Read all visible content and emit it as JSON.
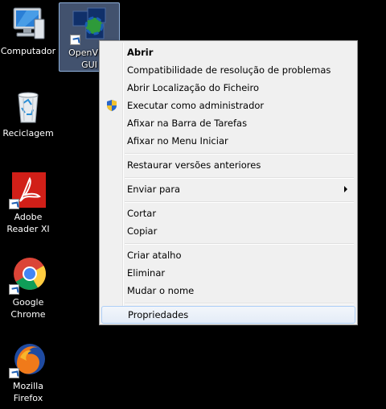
{
  "desktop": {
    "icons": [
      {
        "label": "Computador"
      },
      {
        "label": "OpenVPN\nGUI"
      },
      {
        "label": "Reciclagem"
      },
      {
        "label": "Adobe\nReader XI"
      },
      {
        "label": "Google\nChrome"
      },
      {
        "label": "Mozilla\nFirefox"
      }
    ]
  },
  "context_menu": {
    "items": [
      {
        "label": "Abrir"
      },
      {
        "label": "Compatibilidade de resolução de problemas"
      },
      {
        "label": "Abrir Localização do Ficheiro"
      },
      {
        "label": "Executar como administrador"
      },
      {
        "label": "Afixar na Barra de Tarefas"
      },
      {
        "label": "Afixar no Menu Iniciar"
      },
      {
        "label": "Restaurar versões anteriores"
      },
      {
        "label": "Enviar para"
      },
      {
        "label": "Cortar"
      },
      {
        "label": "Copiar"
      },
      {
        "label": "Criar atalho"
      },
      {
        "label": "Eliminar"
      },
      {
        "label": "Mudar o nome"
      },
      {
        "label": "Propriedades"
      }
    ]
  }
}
